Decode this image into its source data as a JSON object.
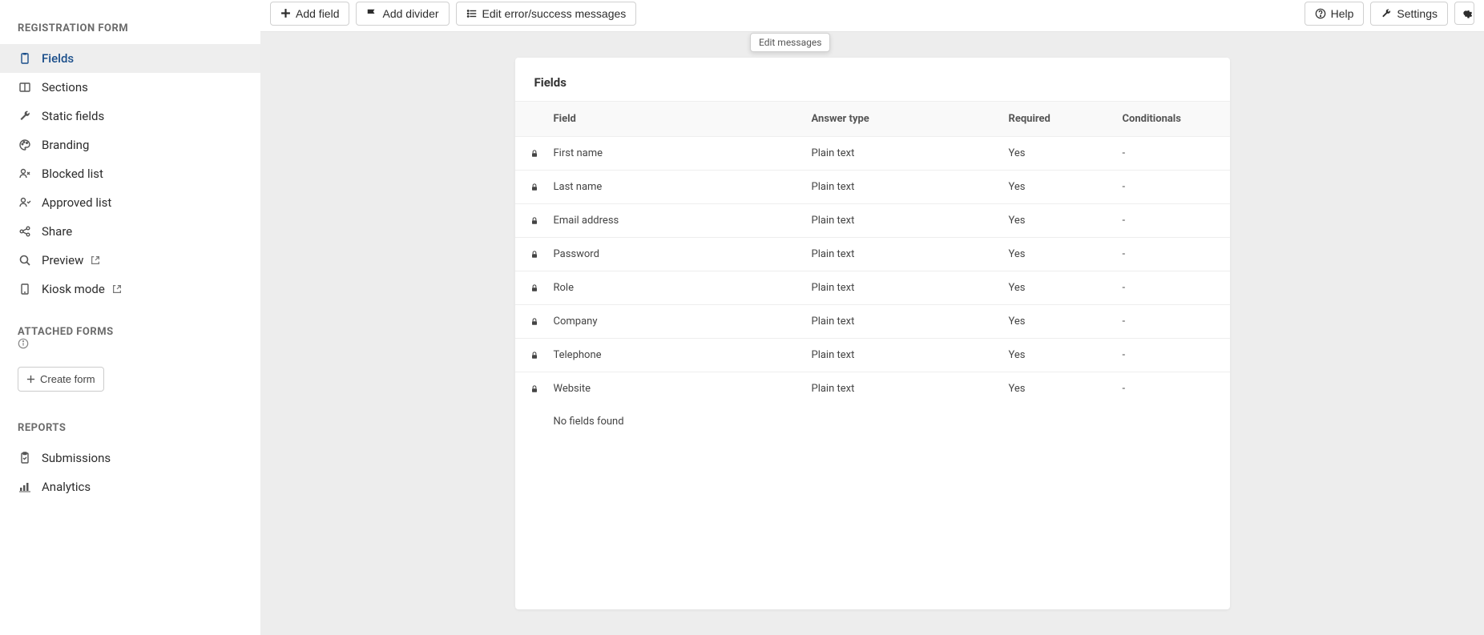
{
  "sidebar": {
    "section1_title": "REGISTRATION FORM",
    "items": [
      {
        "label": "Fields",
        "icon": "clipboard",
        "active": true
      },
      {
        "label": "Sections",
        "icon": "columns"
      },
      {
        "label": "Static fields",
        "icon": "wrench"
      },
      {
        "label": "Branding",
        "icon": "palette"
      },
      {
        "label": "Blocked list",
        "icon": "user-x"
      },
      {
        "label": "Approved list",
        "icon": "user-check"
      },
      {
        "label": "Share",
        "icon": "share"
      },
      {
        "label": "Preview",
        "icon": "search",
        "external": true
      },
      {
        "label": "Kiosk mode",
        "icon": "tablet",
        "external": true
      }
    ],
    "section2_title": "ATTACHED FORMS",
    "create_form_label": "Create form",
    "section3_title": "REPORTS",
    "reports": [
      {
        "label": "Submissions",
        "icon": "clipboard-check"
      },
      {
        "label": "Analytics",
        "icon": "chart"
      }
    ]
  },
  "toolbar": {
    "add_field": "Add field",
    "add_divider": "Add divider",
    "edit_messages": "Edit error/success messages",
    "help": "Help",
    "settings": "Settings"
  },
  "tooltip": "Edit messages",
  "card": {
    "title": "Fields",
    "headers": {
      "field": "Field",
      "answer": "Answer type",
      "required": "Required",
      "conditionals": "Conditionals"
    },
    "rows": [
      {
        "field": "First name",
        "answer": "Plain text",
        "required": "Yes",
        "conditionals": "-"
      },
      {
        "field": "Last name",
        "answer": "Plain text",
        "required": "Yes",
        "conditionals": "-"
      },
      {
        "field": "Email address",
        "answer": "Plain text",
        "required": "Yes",
        "conditionals": "-"
      },
      {
        "field": "Password",
        "answer": "Plain text",
        "required": "Yes",
        "conditionals": "-"
      },
      {
        "field": "Role",
        "answer": "Plain text",
        "required": "Yes",
        "conditionals": "-"
      },
      {
        "field": "Company",
        "answer": "Plain text",
        "required": "Yes",
        "conditionals": "-"
      },
      {
        "field": "Telephone",
        "answer": "Plain text",
        "required": "Yes",
        "conditionals": "-"
      },
      {
        "field": "Website",
        "answer": "Plain text",
        "required": "Yes",
        "conditionals": "-"
      }
    ],
    "no_fields": "No fields found"
  }
}
